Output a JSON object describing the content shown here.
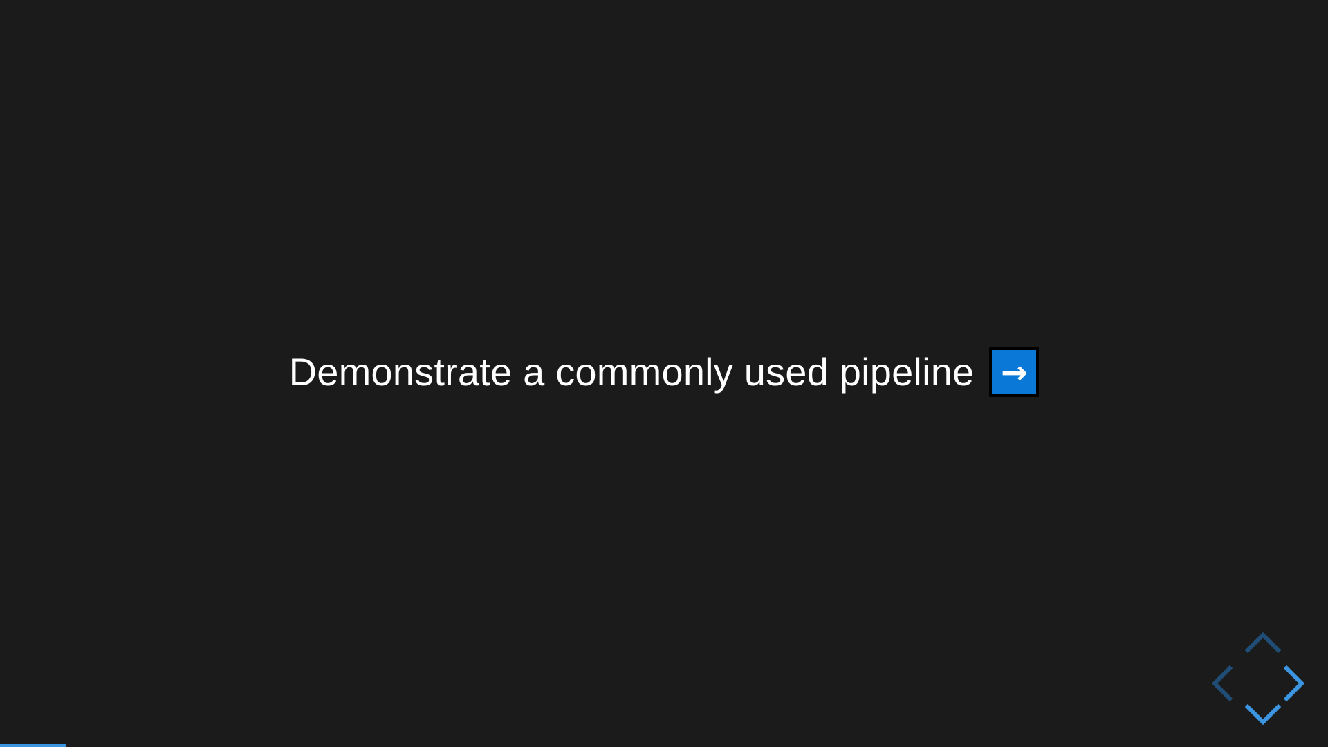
{
  "slide": {
    "text": "Demonstrate a commonly used pipeline",
    "emoji": "➡️",
    "emoji_glyph": "→"
  },
  "controls": {
    "up": {
      "icon": "chevron-up-icon",
      "enabled": false
    },
    "down": {
      "icon": "chevron-down-icon",
      "enabled": true
    },
    "left": {
      "icon": "chevron-left-icon",
      "enabled": false
    },
    "right": {
      "icon": "chevron-right-icon",
      "enabled": true
    }
  },
  "progress": {
    "fraction": 0.05
  },
  "colors": {
    "background": "#1b1b1b",
    "text": "#ffffff",
    "accent": "#3b95e0",
    "accent_dim": "#1f4d75",
    "emoji_box": "#0a78d7"
  }
}
